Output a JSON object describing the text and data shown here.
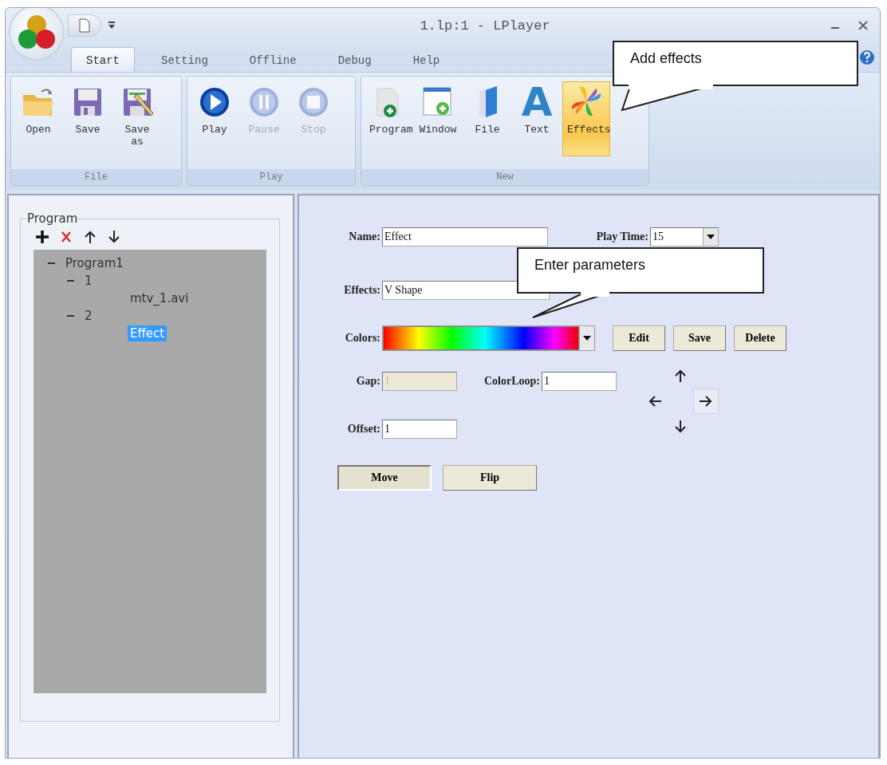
{
  "window": {
    "title": "1.lp:1 - LPlayer"
  },
  "tabs": [
    {
      "label": "Start",
      "selected": true
    },
    {
      "label": "Setting",
      "selected": false
    },
    {
      "label": "Offline",
      "selected": false
    },
    {
      "label": "Debug",
      "selected": false
    },
    {
      "label": "Help",
      "selected": false
    }
  ],
  "ribbon_groups": [
    {
      "label": "File",
      "buttons": [
        {
          "kind": "open",
          "label": "Open",
          "disabled": false,
          "highlighted": false
        },
        {
          "kind": "save",
          "label": "Save",
          "disabled": false,
          "highlighted": false
        },
        {
          "kind": "save-as",
          "label": "Save as",
          "disabled": false,
          "highlighted": false
        }
      ]
    },
    {
      "label": "Play",
      "buttons": [
        {
          "kind": "play",
          "label": "Play",
          "disabled": false,
          "highlighted": false
        },
        {
          "kind": "pause",
          "label": "Pause",
          "disabled": true,
          "highlighted": false
        },
        {
          "kind": "stop",
          "label": "Stop",
          "disabled": true,
          "highlighted": false
        }
      ]
    },
    {
      "label": "New",
      "buttons": [
        {
          "kind": "program",
          "label": "Program",
          "disabled": false,
          "highlighted": false
        },
        {
          "kind": "window",
          "label": "Window",
          "disabled": false,
          "highlighted": false
        },
        {
          "kind": "file",
          "label": "File",
          "disabled": false,
          "highlighted": false
        },
        {
          "kind": "text",
          "glyph": "A",
          "label": "Text",
          "disabled": false,
          "highlighted": false
        },
        {
          "kind": "effects",
          "label": "Effects",
          "disabled": false,
          "highlighted": true
        }
      ]
    }
  ],
  "program_panel": {
    "title": "Program",
    "tree": [
      {
        "label": "Program1",
        "expanded": true,
        "selected": false,
        "children": [
          {
            "label": "1",
            "expanded": true,
            "selected": false,
            "children": [
              {
                "label": "mtv_1.avi",
                "selected": false
              }
            ]
          },
          {
            "label": "2",
            "expanded": true,
            "selected": false,
            "children": [
              {
                "label": "Effect",
                "selected": true
              }
            ]
          }
        ]
      }
    ]
  },
  "form": {
    "name_label": "Name:",
    "name_value": "Effect",
    "play_time_label": "Play Time:",
    "play_time_value": "15",
    "effects_label": "Effects:",
    "effects_value": "V Shape",
    "colors_label": "Colors:",
    "buttons": [
      "Edit",
      "Save",
      "Delete"
    ],
    "gap_label": "Gap:",
    "gap_value": "1",
    "gap_disabled": true,
    "colorloop_label": "ColorLoop:",
    "colorloop_value": "1",
    "offset_label": "Offset:",
    "offset_value": "1",
    "modes": [
      {
        "label": "Move",
        "selected": true
      },
      {
        "label": "Flip",
        "selected": false
      }
    ],
    "directions": [
      {
        "kind": "up",
        "selected": false
      },
      {
        "kind": "left",
        "selected": false
      },
      {
        "kind": "right",
        "selected": true
      },
      {
        "kind": "down",
        "selected": false
      }
    ]
  },
  "callouts": [
    {
      "text": "Add effects"
    },
    {
      "text": "Enter parameters"
    }
  ]
}
